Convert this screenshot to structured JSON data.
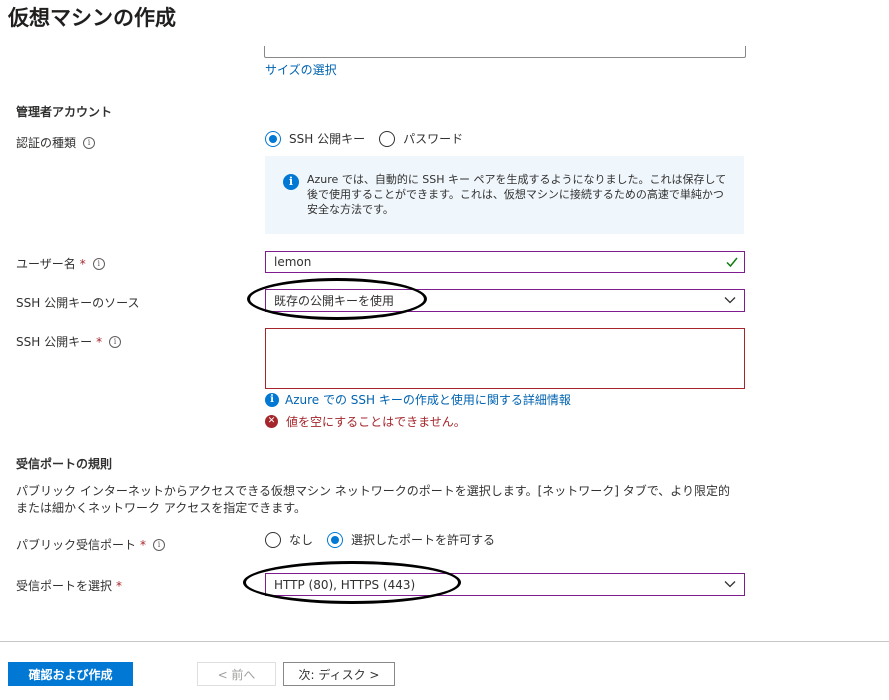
{
  "page": {
    "title": "仮想マシンの作成"
  },
  "size": {
    "link": "サイズの選択"
  },
  "admin": {
    "section_title": "管理者アカウント",
    "auth_type": {
      "label": "認証の種類",
      "options": [
        "SSH 公開キー",
        "パスワード"
      ],
      "selected": "SSH 公開キー"
    },
    "info_message": "Azure では、自動的に SSH キー ペアを生成するようになりました。これは保存して後で使用することができます。これは、仮想マシンに接続するための高速で単純かつ安全な方法です。",
    "username": {
      "label": "ユーザー名",
      "value": "lemon"
    },
    "ssh_source": {
      "label": "SSH 公開キーのソース",
      "value": "既存の公開キーを使用"
    },
    "ssh_key": {
      "label": "SSH 公開キー",
      "value": "",
      "help_link": "Azure での SSH キーの作成と使用に関する詳細情報",
      "error": "値を空にすることはできません。"
    }
  },
  "inbound": {
    "section_title": "受信ポートの規則",
    "description": "パブリック インターネットからアクセスできる仮想マシン ネットワークのポートを選択します。[ネットワーク] タブで、より限定的または細かくネットワーク アクセスを指定できます。",
    "public_ports": {
      "label": "パブリック受信ポート",
      "options": [
        "なし",
        "選択したポートを許可する"
      ],
      "selected": "選択したポートを許可する"
    },
    "select_ports": {
      "label": "受信ポートを選択",
      "value": "HTTP (80), HTTPS (443)"
    }
  },
  "footer": {
    "review_create": "確認および作成",
    "prev": "< 前へ",
    "next": "次: ディスク >"
  },
  "colors": {
    "accent": "#0078d4",
    "error": "#a4262c",
    "focus_border": "#7f1c8f"
  }
}
